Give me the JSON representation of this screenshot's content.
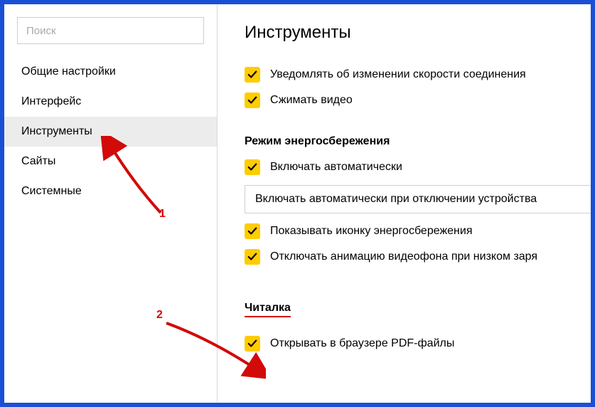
{
  "search": {
    "placeholder": "Поиск"
  },
  "nav": {
    "items": [
      {
        "label": "Общие настройки",
        "active": false
      },
      {
        "label": "Интерфейс",
        "active": false
      },
      {
        "label": "Инструменты",
        "active": true
      },
      {
        "label": "Сайты",
        "active": false
      },
      {
        "label": "Системные",
        "active": false
      }
    ]
  },
  "page": {
    "title": "Инструменты"
  },
  "top_options": [
    {
      "label": "Уведомлять об изменении скорости соединения",
      "checked": true
    },
    {
      "label": "Сжимать видео",
      "checked": true
    }
  ],
  "energy": {
    "title": "Режим энергосбережения",
    "auto": {
      "label": "Включать автоматически",
      "checked": true
    },
    "select_value": "Включать автоматически при отключении устройства",
    "show_icon": {
      "label": "Показывать иконку энергосбережения",
      "checked": true
    },
    "disable_anim": {
      "label": "Отключать анимацию видеофона при низком заря",
      "checked": true
    }
  },
  "reader": {
    "title": "Читалка",
    "open_pdf": {
      "label": "Открывать в браузере PDF-файлы",
      "checked": true
    }
  },
  "annotations": {
    "n1": "1",
    "n2": "2"
  }
}
